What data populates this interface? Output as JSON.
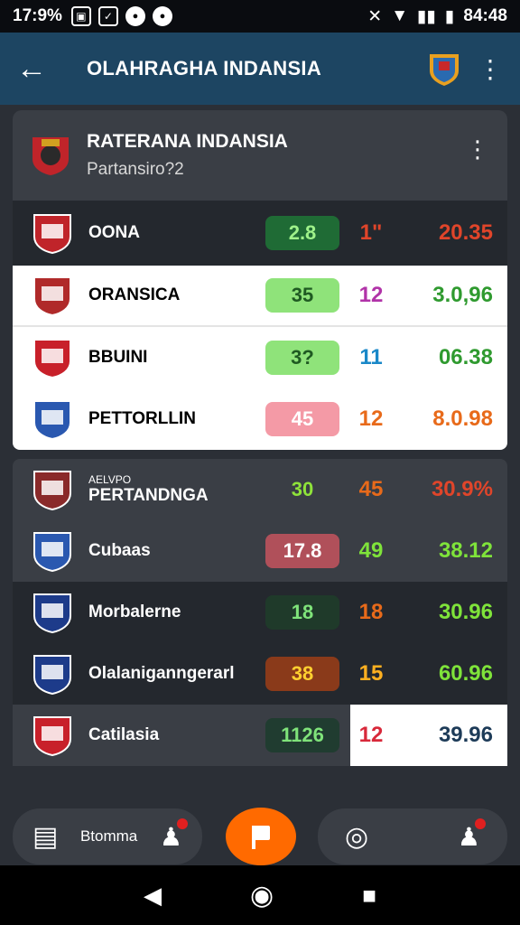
{
  "status": {
    "time": "17:9%",
    "clock": "84:48"
  },
  "appbar": {
    "title": "OLAHRAGHA INDANSIA"
  },
  "card": {
    "title": "RATERANA INDANSIA",
    "subtitle": "Partansiro?2"
  },
  "rows": [
    {
      "name": "OONA",
      "v1": "2.8",
      "v2": "1\"",
      "v3": "20.35",
      "theme": "dark",
      "pill": "#1f6b35",
      "c1": "#9ff28a",
      "c2": "#e0452a",
      "c3": "#e0452a"
    },
    {
      "name": "ORANSICA",
      "v1": "35",
      "v2": "12",
      "v3": "3.0,96",
      "theme": "white",
      "pill": "#8fe37a",
      "c1": "#1f5a22",
      "c2": "#b133a8",
      "c3": "#2f9a2f"
    },
    {
      "name": "BBUINI",
      "v1": "3?",
      "v2": "11",
      "v3": "06.38",
      "theme": "white",
      "pill": "#8fe37a",
      "c1": "#1f5a22",
      "c2": "#1a88c8",
      "c3": "#2f9a2f"
    },
    {
      "name": "PETTORLLIN",
      "v1": "45",
      "v2": "12",
      "v3": "8.0.98",
      "theme": "white",
      "pill": "#f49aa6",
      "c1": "#ffffff",
      "c2": "#e86a1a",
      "c3": "#e86a1a"
    },
    {
      "name": "PERTANDNGA",
      "small": "AELVPO",
      "v1": "30",
      "v2": "45",
      "v3": "30.9%",
      "theme": "gray",
      "pill": "transparent",
      "c1": "#8fe33a",
      "c2": "#e86a1a",
      "c3": "#e0452a"
    },
    {
      "name": "Cubaas",
      "v1": "17.8",
      "v2": "49",
      "v3": "38.12",
      "theme": "gray",
      "pill": "#b0505a",
      "c1": "#ffffff",
      "c2": "#7fe33a",
      "c3": "#7fe33a"
    },
    {
      "name": "Morbalerne",
      "v1": "18",
      "v2": "18",
      "v3": "30.96",
      "theme": "dark",
      "pill": "#1f3a2a",
      "c1": "#7fe37a",
      "c2": "#e86a1a",
      "c3": "#7fe33a"
    },
    {
      "name": "Olalaniganngerarl",
      "v1": "38",
      "v2": "15",
      "v3": "60.96",
      "theme": "dark",
      "pill": "#8a3a1a",
      "c1": "#ffd030",
      "c2": "#ffb020",
      "c3": "#7fe33a"
    },
    {
      "name": "Catilasia",
      "v1": "1126",
      "v2": "12",
      "v3": "39.96",
      "theme": "split",
      "pill": "#203c30",
      "c1": "#7fe37a",
      "c2": "#d8283a",
      "c3": "#1d3b58"
    }
  ],
  "bottomnav": {
    "left_label": "Btomma"
  }
}
